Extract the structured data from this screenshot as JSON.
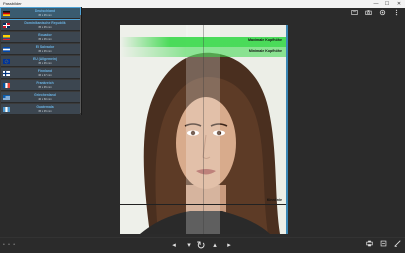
{
  "window": {
    "title": "Passbilder",
    "minimize": "—",
    "maximize": "☐",
    "close": "✕"
  },
  "toolbar": {
    "icons": [
      "crop-icon",
      "camera-icon",
      "settings-icon",
      "more-icon"
    ]
  },
  "countries": [
    {
      "name": "Deutschland",
      "size": "35 x 45 mm",
      "flag": "de",
      "selected": true
    },
    {
      "name": "Dominikanische Republik",
      "size": "35 x 45 mm",
      "flag": "do",
      "selected": false
    },
    {
      "name": "Ecuador",
      "size": "35 x 45 mm",
      "flag": "ec",
      "selected": false
    },
    {
      "name": "El Salvador",
      "size": "35 x 45 mm",
      "flag": "sv",
      "selected": false
    },
    {
      "name": "EU (Allgemein)",
      "size": "35 x 45 mm",
      "flag": "eu",
      "selected": false
    },
    {
      "name": "Finnland",
      "size": "36 x 47 mm",
      "flag": "fi",
      "selected": false
    },
    {
      "name": "Frankreich",
      "size": "35 x 45 mm",
      "flag": "fr",
      "selected": false
    },
    {
      "name": "Griechenland",
      "size": "40 x 60 mm",
      "flag": "gr",
      "selected": false
    },
    {
      "name": "Guatemala",
      "size": "35 x 45 mm",
      "flag": "gt",
      "selected": false
    }
  ],
  "photo": {
    "max_head_label": "Maximale Kopfhöhe",
    "min_head_label": "Minimale Kopfhöhe",
    "chin_label": "Kinnlinie"
  },
  "colors": {
    "accent": "#4fa3d6",
    "guide_green": "#39d94a",
    "country_name": "#6ab3e4"
  },
  "bottombar": {
    "dots": "• • •",
    "prev": "◂",
    "down": "▾",
    "rotate": "↻",
    "up": "▴",
    "next": "▸"
  }
}
